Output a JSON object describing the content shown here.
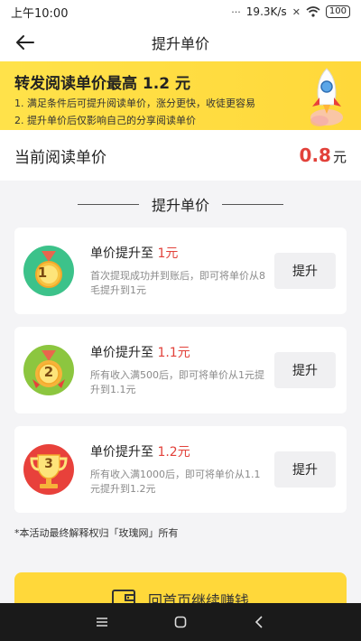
{
  "status_bar": {
    "time": "上午10:00",
    "icons_text": "···",
    "net_speed": "19.3K/s",
    "battery": "100"
  },
  "nav": {
    "title": "提升单价"
  },
  "banner": {
    "title_prefix": "转发阅读单价最高",
    "title_value": "1.2",
    "title_unit": "元",
    "line1": "1. 满足条件后可提升阅读单价，涨分更快，收徒更容易",
    "line2": "2. 提升单价后仅影响自己的分享阅读单价"
  },
  "current_price": {
    "label": "当前阅读单价",
    "value": "0.8",
    "unit": "元"
  },
  "section": {
    "title": "提升单价"
  },
  "levels": [
    {
      "badge": "1",
      "heading_prefix": "单价提升至",
      "amount": "1",
      "unit": "元",
      "desc": "首次提现成功并到账后，即可将单价从8毛提升到1元",
      "button": "提升"
    },
    {
      "badge": "2",
      "heading_prefix": "单价提升至",
      "amount": "1.1",
      "unit": "元",
      "desc": "所有收入满500后，即可将单价从1元提升到1.1元",
      "button": "提升"
    },
    {
      "badge": "3",
      "heading_prefix": "单价提升至",
      "amount": "1.2",
      "unit": "元",
      "desc": "所有收入满1000后，即可将单价从1.1元提升到1.2元",
      "button": "提升"
    }
  ],
  "footnote": "*本活动最终解释权归「玫瑰网」所有",
  "cta": {
    "label": "回首页继续赚钱"
  },
  "colors": {
    "accent_red": "#e2413a",
    "banner_yellow": "#ffe24a",
    "cta_yellow": "#ffd83a",
    "medal_green": "#3cc28a",
    "medal_lime": "#8cc63f",
    "medal_red": "#e8413b"
  },
  "icons": {
    "back": "arrow-left-icon",
    "rocket": "rocket-icon",
    "medal": "medal-icon",
    "trophy": "trophy-icon",
    "wallet": "wallet-icon"
  }
}
